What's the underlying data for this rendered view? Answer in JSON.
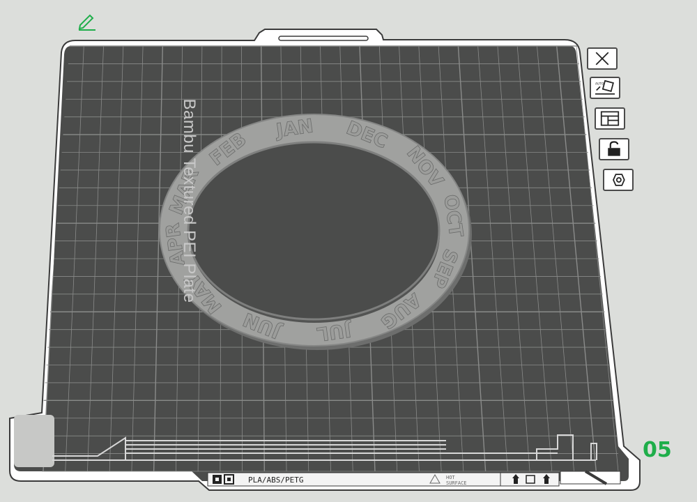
{
  "plate": {
    "name": "Bambu Textured PEI Plate",
    "number": "05",
    "bottom_bar": {
      "filaments": "PLA/ABS/PETG",
      "warning_line1": "HOT",
      "warning_line2": "SURFACE"
    }
  },
  "model": {
    "months": [
      "JAN",
      "FEB",
      "MAR",
      "APR",
      "MAY",
      "JUN",
      "JUL",
      "AUG",
      "SEP",
      "OCT",
      "NOV",
      "DEC"
    ]
  },
  "toolbar": {
    "buttons": [
      {
        "name": "close-plate-button",
        "icon": "close-icon"
      },
      {
        "name": "auto-orient-button",
        "icon": "auto-orient-icon",
        "label": "AUTO"
      },
      {
        "name": "arrange-button",
        "icon": "arrange-icon"
      },
      {
        "name": "lock-button",
        "icon": "lock-icon"
      },
      {
        "name": "plate-settings-button",
        "icon": "settings-icon"
      }
    ]
  },
  "colors": {
    "background": "#dcdedb",
    "plate": "#4b4c4b",
    "grid": "#8a8b8a",
    "model": "#9a9b9a",
    "accent_green": "#1fae4a"
  }
}
